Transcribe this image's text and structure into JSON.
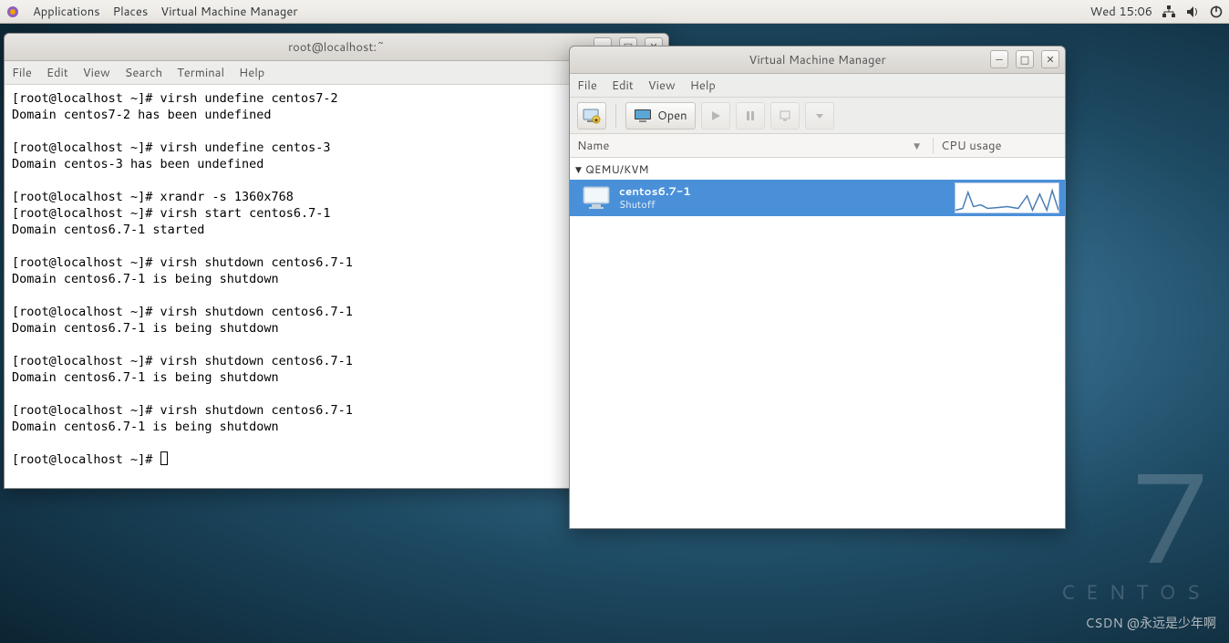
{
  "panel": {
    "apps": "Applications",
    "places": "Places",
    "active_app": "Virtual Machine Manager",
    "clock": "Wed 15:06"
  },
  "terminal": {
    "title": "root@localhost:~",
    "menus": [
      "File",
      "Edit",
      "View",
      "Search",
      "Terminal",
      "Help"
    ],
    "lines": "[root@localhost ~]# virsh undefine centos7-2\nDomain centos7-2 has been undefined\n\n[root@localhost ~]# virsh undefine centos-3\nDomain centos-3 has been undefined\n\n[root@localhost ~]# xrandr -s 1360x768\n[root@localhost ~]# virsh start centos6.7-1\nDomain centos6.7-1 started\n\n[root@localhost ~]# virsh shutdown centos6.7-1\nDomain centos6.7-1 is being shutdown\n\n[root@localhost ~]# virsh shutdown centos6.7-1\nDomain centos6.7-1 is being shutdown\n\n[root@localhost ~]# virsh shutdown centos6.7-1\nDomain centos6.7-1 is being shutdown\n\n[root@localhost ~]# virsh shutdown centos6.7-1\nDomain centos6.7-1 is being shutdown\n\n[root@localhost ~]# "
  },
  "vmm": {
    "title": "Virtual Machine Manager",
    "menus": [
      "File",
      "Edit",
      "View",
      "Help"
    ],
    "open_label": "Open",
    "columns": {
      "name": "Name",
      "cpu": "CPU usage"
    },
    "group": "QEMU/KVM",
    "vm": {
      "name": "centos6.7-1",
      "state": "Shutoff"
    }
  },
  "branding": {
    "ver": "7",
    "name": "CENTOS"
  },
  "watermark": "CSDN @永远是少年啊"
}
